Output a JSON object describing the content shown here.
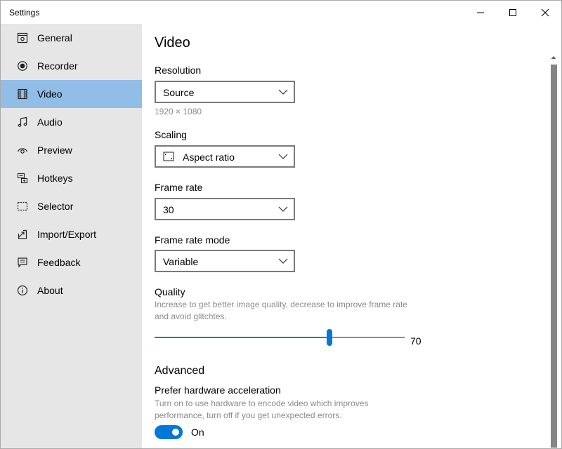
{
  "window": {
    "title": "Settings"
  },
  "sidebar": {
    "items": [
      {
        "label": "General",
        "icon": "monitor-settings-icon",
        "active": false
      },
      {
        "label": "Recorder",
        "icon": "record-icon",
        "active": false
      },
      {
        "label": "Video",
        "icon": "film-icon",
        "active": true
      },
      {
        "label": "Audio",
        "icon": "music-note-icon",
        "active": false
      },
      {
        "label": "Preview",
        "icon": "eye-icon",
        "active": false
      },
      {
        "label": "Hotkeys",
        "icon": "keyboard-shortcut-icon",
        "active": false
      },
      {
        "label": "Selector",
        "icon": "dashed-selection-icon",
        "active": false
      },
      {
        "label": "Import/Export",
        "icon": "import-export-icon",
        "active": false
      },
      {
        "label": "Feedback",
        "icon": "feedback-icon",
        "active": false
      },
      {
        "label": "About",
        "icon": "info-icon",
        "active": false
      }
    ],
    "active_color": "#91bde6"
  },
  "main": {
    "title": "Video",
    "resolution": {
      "label": "Resolution",
      "value": "Source",
      "hint": "1920 × 1080"
    },
    "scaling": {
      "label": "Scaling",
      "value": "Aspect ratio",
      "icon": "aspect-ratio-icon"
    },
    "frame_rate": {
      "label": "Frame rate",
      "value": "30"
    },
    "frame_rate_mode": {
      "label": "Frame rate mode",
      "value": "Variable"
    },
    "quality": {
      "label": "Quality",
      "hint_line1": "Increase to get better image quality, decrease to improve frame rate",
      "hint_line2": "and avoid glitchtes.",
      "value": 70,
      "value_label": "70",
      "fill_fraction": 0.7
    },
    "advanced": {
      "title": "Advanced",
      "hw_accel": {
        "label": "Prefer hardware acceleration",
        "hint_line1": "Turn on to use hardware to encode video which improves",
        "hint_line2": "performance, turn off if you get unexpected errors.",
        "state": "On",
        "on": true
      }
    }
  },
  "colors": {
    "accent": "#0078d7",
    "sidebar_bg": "#e6e6e6",
    "hint_text": "#8a8a8a"
  }
}
